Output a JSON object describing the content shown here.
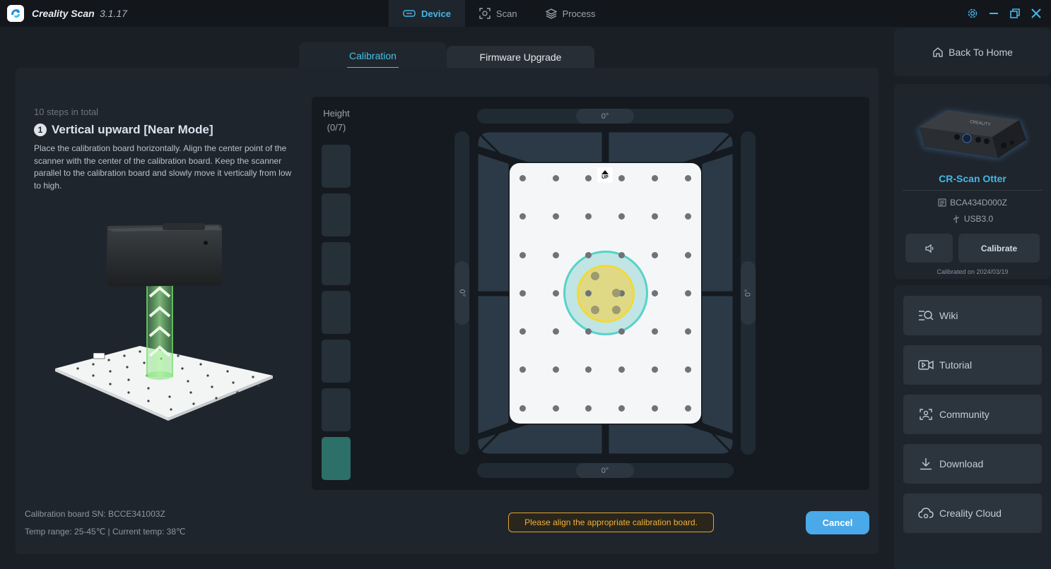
{
  "app": {
    "title": "Creality Scan",
    "version": "3.1.17"
  },
  "top_tabs": [
    {
      "label": "Device",
      "icon": "device-icon",
      "active": true
    },
    {
      "label": "Scan",
      "icon": "scan-icon",
      "active": false
    },
    {
      "label": "Process",
      "icon": "layers-icon",
      "active": false
    }
  ],
  "sub_tabs": {
    "calibration": "Calibration",
    "firmware": "Firmware Upgrade"
  },
  "step": {
    "total": "10 steps in total",
    "number": "1",
    "title": "Vertical upward [Near Mode]",
    "description": "Place the calibration board horizontally. Align the center point of the scanner with the center of the calibration board. Keep the scanner parallel to the calibration board and slowly move it vertically from low to high."
  },
  "height": {
    "label": "Height",
    "progress": "(0/7)",
    "segments": 7,
    "filled": 1
  },
  "angles": {
    "top": "0°",
    "bottom": "0°",
    "left": "0°",
    "right": "0°"
  },
  "board": {
    "marker": "UP",
    "rows": 7,
    "cols": 6
  },
  "footer": {
    "board_sn": "Calibration board SN:  BCCE341003Z",
    "temp": "Temp range: 25-45℃  |   Current temp: 38℃"
  },
  "alert": "Please align the appropriate calibration board.",
  "cancel_label": "Cancel",
  "sidebar": {
    "back_home": "Back To Home",
    "device": {
      "name": "CR-Scan Otter",
      "serial": "BCA434D000Z",
      "connection": "USB3.0",
      "calibrate_label": "Calibrate",
      "calibrated_on": "Calibrated on 2024/03/19"
    },
    "links": [
      {
        "label": "Wiki",
        "icon": "wiki-icon"
      },
      {
        "label": "Tutorial",
        "icon": "video-icon"
      },
      {
        "label": "Community",
        "icon": "community-icon"
      },
      {
        "label": "Download",
        "icon": "download-icon"
      },
      {
        "label": "Creality Cloud",
        "icon": "cloud-icon"
      }
    ]
  },
  "colors": {
    "accent": "#45b7e8",
    "teal": "#58d1c9",
    "warning": "#f0b13a",
    "bg": "#1a1f25"
  }
}
